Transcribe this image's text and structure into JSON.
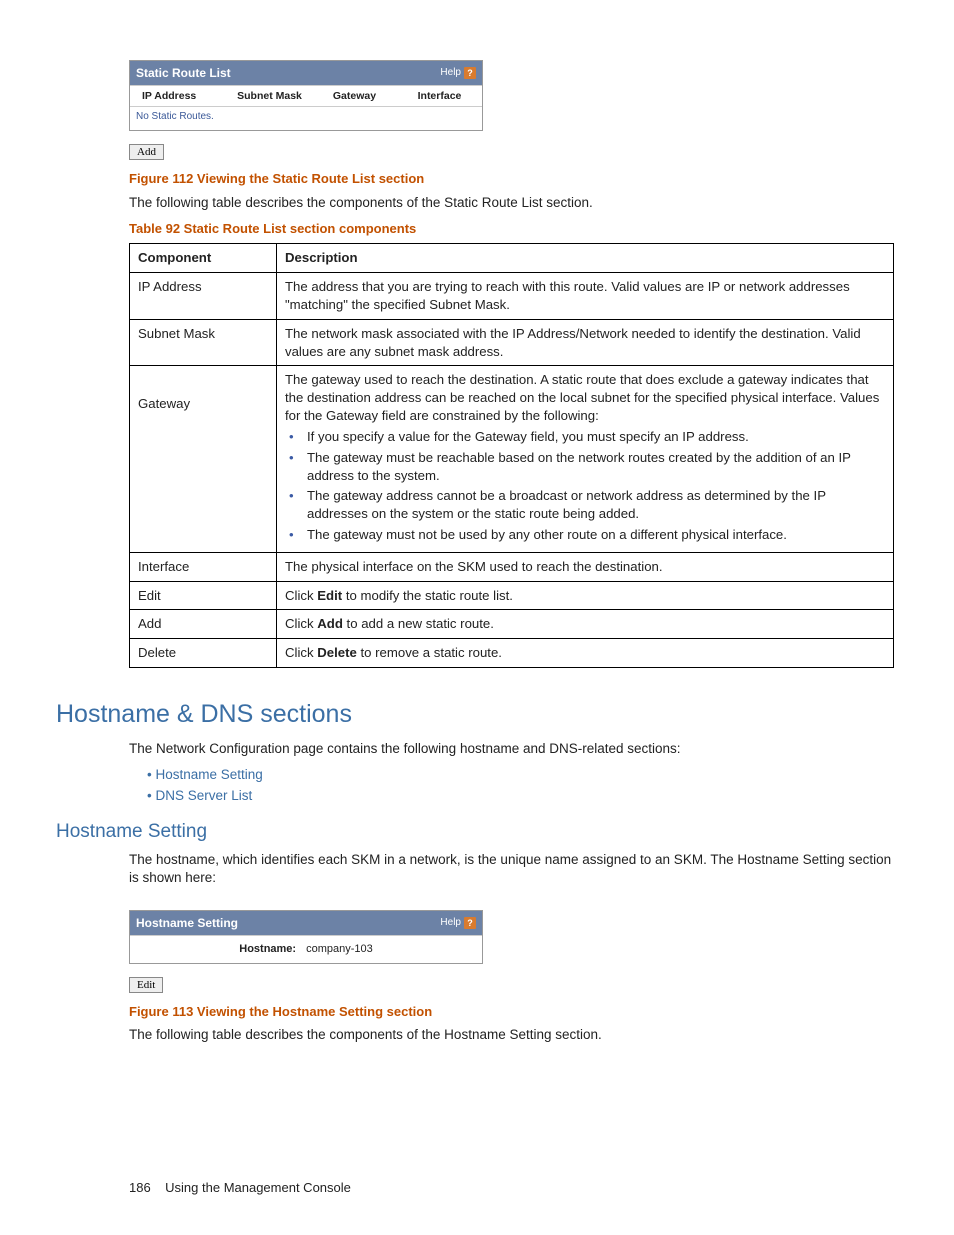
{
  "staticRoutePanel": {
    "title": "Static Route List",
    "help": "Help",
    "columns": [
      "IP Address",
      "Subnet Mask",
      "Gateway",
      "Interface"
    ],
    "empty": "No Static Routes.",
    "addBtn": "Add"
  },
  "figure112": "Figure 112 Viewing the Static Route List section",
  "figure112_desc": "The following table describes the components of the Static Route List section.",
  "table92_caption": "Table 92 Static Route List section components",
  "table92_headers": [
    "Component",
    "Description"
  ],
  "table92": {
    "ip": {
      "name": "IP Address",
      "desc": "The address that you are trying to reach with this route. Valid values are IP or network addresses \"matching\" the specified Subnet Mask."
    },
    "mask": {
      "name": "Subnet Mask",
      "desc": "The network mask associated with the IP Address/Network needed to identify the destination. Valid values are any subnet mask address."
    },
    "gateway": {
      "name": "Gateway",
      "intro": "The gateway used to reach the destination. A static route that does exclude a gateway indicates that the destination address can be reached on the local subnet for the specified physical interface. Values for the Gateway field are constrained by the following:",
      "b1": "If you specify a value for the Gateway field, you must specify an IP address.",
      "b2": "The gateway must be reachable based on the network routes created by the addition of an IP address to the system.",
      "b3": "The gateway address cannot be a broadcast or network address as determined by the IP addresses on the system or the static route being added.",
      "b4": "The gateway must not be used by any other route on a different physical interface."
    },
    "iface": {
      "name": "Interface",
      "desc": "The physical interface on the SKM used to reach the destination."
    },
    "edit": {
      "name": "Edit",
      "pre": "Click ",
      "bold": "Edit",
      "post": " to modify the static route list."
    },
    "add": {
      "name": "Add",
      "pre": "Click ",
      "bold": "Add",
      "post": " to add a new static route."
    },
    "del": {
      "name": "Delete",
      "pre": "Click ",
      "bold": "Delete",
      "post": " to remove a static route."
    }
  },
  "h1": "Hostname & DNS sections",
  "h1_intro": "The Network Configuration page contains the following hostname and DNS-related sections:",
  "links": [
    "Hostname Setting",
    "DNS Server List"
  ],
  "h2": "Hostname Setting",
  "h2_intro": "The hostname, which identifies each SKM in a network, is the unique name assigned to an SKM. The Hostname Setting section is shown here:",
  "hostnamePanel": {
    "title": "Hostname Setting",
    "help": "Help",
    "label": "Hostname:",
    "value": "company-103",
    "editBtn": "Edit"
  },
  "figure113": "Figure 113 Viewing the Hostname Setting section",
  "figure113_desc": "The following table describes the components of the Hostname Setting section.",
  "footer": {
    "page": "186",
    "title": "Using the Management Console"
  }
}
